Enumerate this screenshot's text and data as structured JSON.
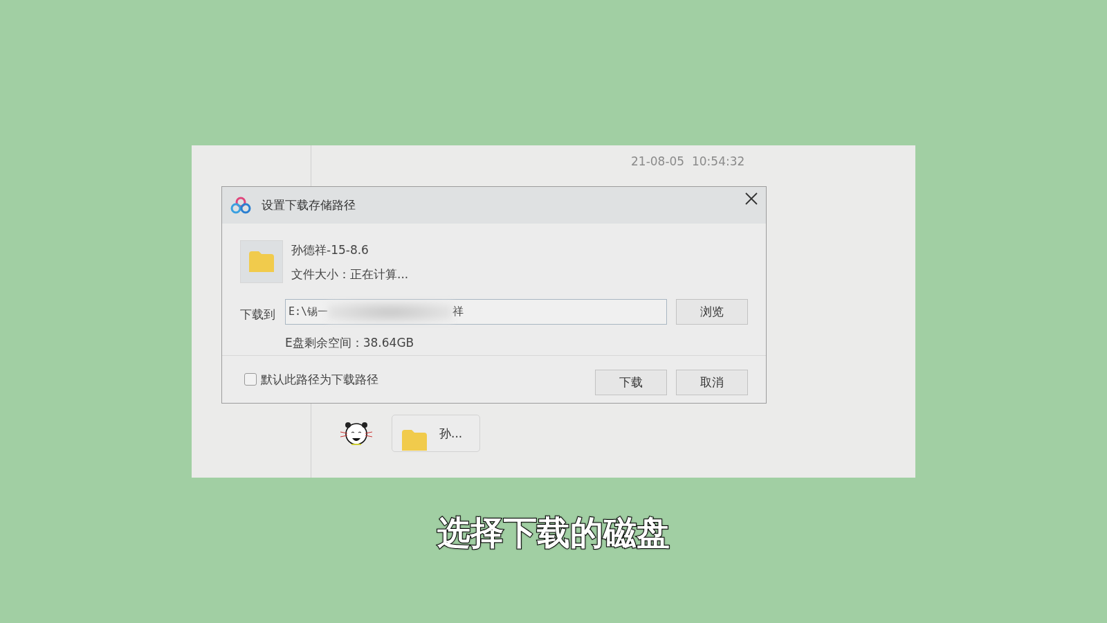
{
  "chat": {
    "timestamp": "21-08-05  10:54:32",
    "message": {
      "kind": "folder",
      "label": "孙..."
    }
  },
  "dialog": {
    "title": "设置下载存储路径",
    "file": {
      "name": "孙德祥-15-8.6",
      "size": "文件大小：正在计算..."
    },
    "path": {
      "label": "下载到",
      "value_start": "E:\\锡一",
      "value_end": "祥",
      "blurred": true
    },
    "browse_button": "浏览",
    "free_space": "E盘剩余空间：38.64GB",
    "default_checkbox": {
      "label": "默认此路径为下载路径",
      "checked": false
    },
    "buttons": [
      "下载",
      "取消"
    ]
  },
  "subtitle": "选择下载的磁盘"
}
